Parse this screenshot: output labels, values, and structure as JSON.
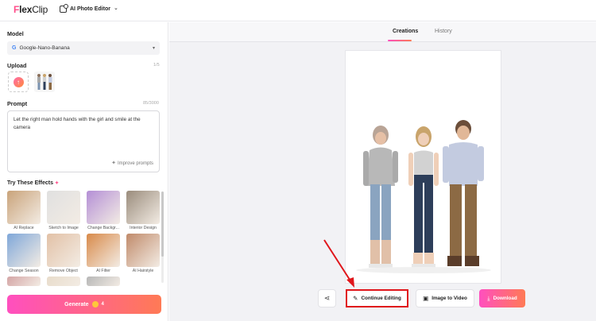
{
  "header": {
    "logo_f": "F",
    "logo_rest": "lex",
    "logo_clip": "Clip",
    "editor_label": "AI Photo Editor",
    "editor_chevron": "⌄"
  },
  "left": {
    "model_label": "Model",
    "model_value": "Google-Nano-Banana",
    "upload_label": "Upload",
    "upload_count": "1/5",
    "prompt_label": "Prompt",
    "prompt_count": "85/3000",
    "prompt_text": "Let the right man hold hands with the girl and smile at the camera",
    "improve_label": "Improve prompts",
    "effects_label": "Try These Effects",
    "effects": [
      {
        "name": "AI Replace",
        "color": "#c9a37a"
      },
      {
        "name": "Sketch to Image",
        "color": "#e0e0e0"
      },
      {
        "name": "Change Backgr...",
        "color": "#b48fd6"
      },
      {
        "name": "Interior Design",
        "color": "#9a8c7c"
      },
      {
        "name": "Change Season",
        "color": "#7fa7d9"
      },
      {
        "name": "Remove Object",
        "color": "#e2c1a6"
      },
      {
        "name": "AI Filter",
        "color": "#d88a4a"
      },
      {
        "name": "AI Hairstyle",
        "color": "#c08a6a"
      },
      {
        "name": "",
        "color": "#d4a5a5"
      },
      {
        "name": "",
        "color": "#e8dccb"
      },
      {
        "name": "",
        "color": "#b7b7b7"
      }
    ],
    "generate_label": "Generate",
    "generate_count": "4"
  },
  "right": {
    "tab_creations": "Creations",
    "tab_history": "History",
    "continue_label": "Continue Editing",
    "image_to_video_label": "Image to Video",
    "download_label": "Download"
  },
  "colors": {
    "accent_pink": "#ff4fbf",
    "accent_orange": "#ff7a55",
    "highlight_red": "#e0161b"
  }
}
